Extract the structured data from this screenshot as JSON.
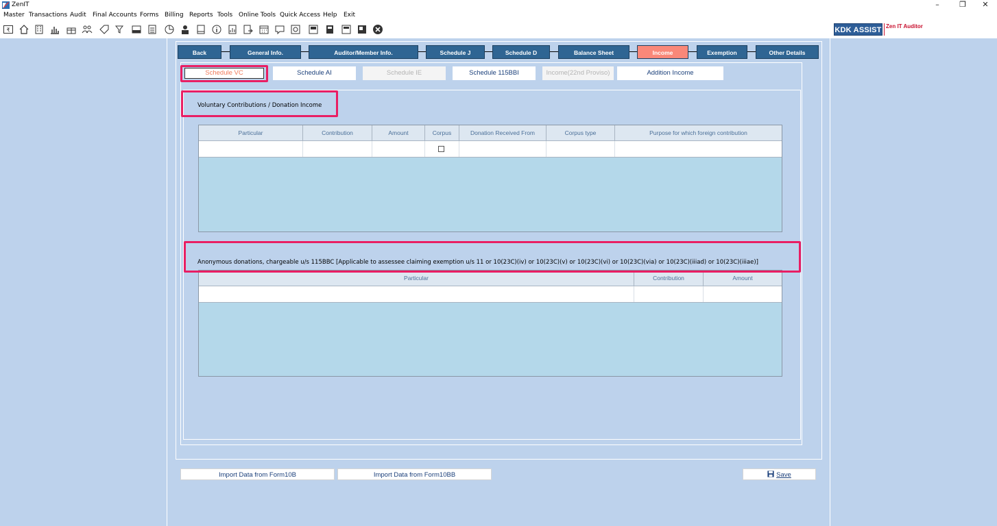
{
  "window": {
    "title": "ZenIT",
    "minimize": "–",
    "restore": "❐",
    "close": "✕"
  },
  "menu": [
    "Master",
    "Transactions",
    "Audit",
    "Final Accounts",
    "Forms",
    "Billing",
    "Reports",
    "Tools",
    "Online Tools",
    "Quick Access",
    "Help",
    "Exit"
  ],
  "branding": {
    "kdk_assist": "KDK ASSIST",
    "product": "Zen IT Auditor"
  },
  "nav_tabs": [
    {
      "label": "Back"
    },
    {
      "label": "General Info."
    },
    {
      "label": "Auditor/Member Info."
    },
    {
      "label": "Schedule J"
    },
    {
      "label": "Schedule D"
    },
    {
      "label": "Balance Sheet"
    },
    {
      "label": "Income",
      "active": true
    },
    {
      "label": "Exemption"
    },
    {
      "label": "Other Details"
    }
  ],
  "sub_tabs": [
    {
      "label": "Schedule VC",
      "state": "active"
    },
    {
      "label": "Schedule AI",
      "state": "normal"
    },
    {
      "label": "Schedule IE",
      "state": "disabled"
    },
    {
      "label": "Schedule 115BBI",
      "state": "normal"
    },
    {
      "label": "Income(22nd Proviso)",
      "state": "disabled"
    },
    {
      "label": "Addition Income",
      "state": "normal"
    }
  ],
  "section1": {
    "title": "Voluntary Contributions / Donation Income",
    "columns": [
      "Particular",
      "Contribution",
      "Amount",
      "Corpus",
      "Donation Received From",
      "Corpus type",
      "Purpose for which foreign contribution"
    ]
  },
  "section2": {
    "title": "Anonymous donations, chargeable u/s 115BBC [Applicable to assessee claiming exemption u/s 11 or 10(23C)(iv) or 10(23C)(v) or 10(23C)(vi) or 10(23C)(via) or 10(23C)(iiiad) or 10(23C)(iiiae)]",
    "columns": [
      "Particular",
      "Contribution",
      "Amount"
    ]
  },
  "buttons": {
    "import_10b": "Import Data from Form10B",
    "import_10bb": "Import Data from Form10BB",
    "save": "Save"
  },
  "colors": {
    "nav_tab": "#2f6593",
    "nav_active": "#f98879",
    "background": "#bdd2ec",
    "grid_body": "#b4d8ea",
    "highlight": "#e91e63"
  }
}
